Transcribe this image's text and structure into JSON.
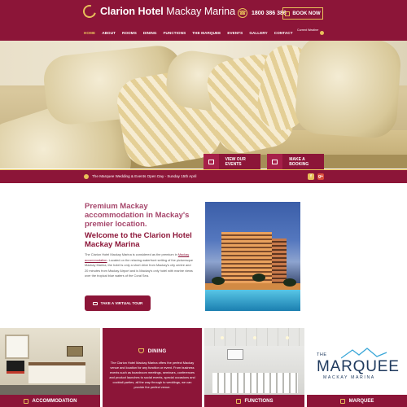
{
  "header": {
    "brand_bold": "Clarion Hotel",
    "brand_light": "Mackay Marina",
    "phone": "1800 386 386",
    "book_now": "BOOK NOW",
    "weather_title": "Current Weather"
  },
  "nav": {
    "items": [
      "HOME",
      "ABOUT",
      "ROOMS",
      "DINING",
      "FUNCTIONS",
      "THE MARQUEE",
      "EVENTS",
      "GALLERY",
      "CONTACT"
    ]
  },
  "hero": {
    "btn_events": "VIEW OUR EVENTS",
    "btn_booking": "MAKE A BOOKING"
  },
  "announcement": {
    "text": "The Marquee Wedding & Events Open Day - Sunday 15th April",
    "facebook": "f",
    "google": "g+"
  },
  "intro": {
    "heading": "Premium Mackay accommodation in Mackay's premier location.",
    "welcome": "Welcome to the Clarion Hotel Mackay Marina",
    "para_before": "The Clarion Hotel Mackay Marina is considered as the premium in ",
    "para_link": "Mackay accommodation",
    "para_after": ". Located on the relaxing waterfront setting of the picturesque Mackay Marina, the hotel is only a short drive from Mackay's city centre and 20 minutes from Mackay Airport and is Mackay's only hotel with marine views over the tropical blue waters of the Coral Sea.",
    "tour_button": "TAKE A VIRTUAL TOUR"
  },
  "tiles": {
    "accommodation": "ACCOMMODATION",
    "dining_title": "DINING",
    "dining_text": "The Clarion Hotel Mackay Marina offers the perfect Mackay venue and location for any function or event. From business events such as boardroom meetings, seminars, conferences and product launches to social events, special occasions and cocktail parties, all the way through to weddings, we can provide the perfect venue.",
    "functions": "FUNCTIONS",
    "marquee": "MARQUEE",
    "marquee_logo_the": "THE",
    "marquee_logo_name": "MARQUEE",
    "marquee_logo_sub": "MACKAY MARINA"
  },
  "icons": {
    "logo": "clarion-swirl-icon",
    "phone": "phone-icon",
    "calendar": "calendar-icon",
    "weather": "sun-icon"
  },
  "colors": {
    "primary": "#8c1538",
    "accent": "#e8c05a",
    "heading_pink": "#a6466b",
    "marquee_blue": "#1f3a5e"
  }
}
